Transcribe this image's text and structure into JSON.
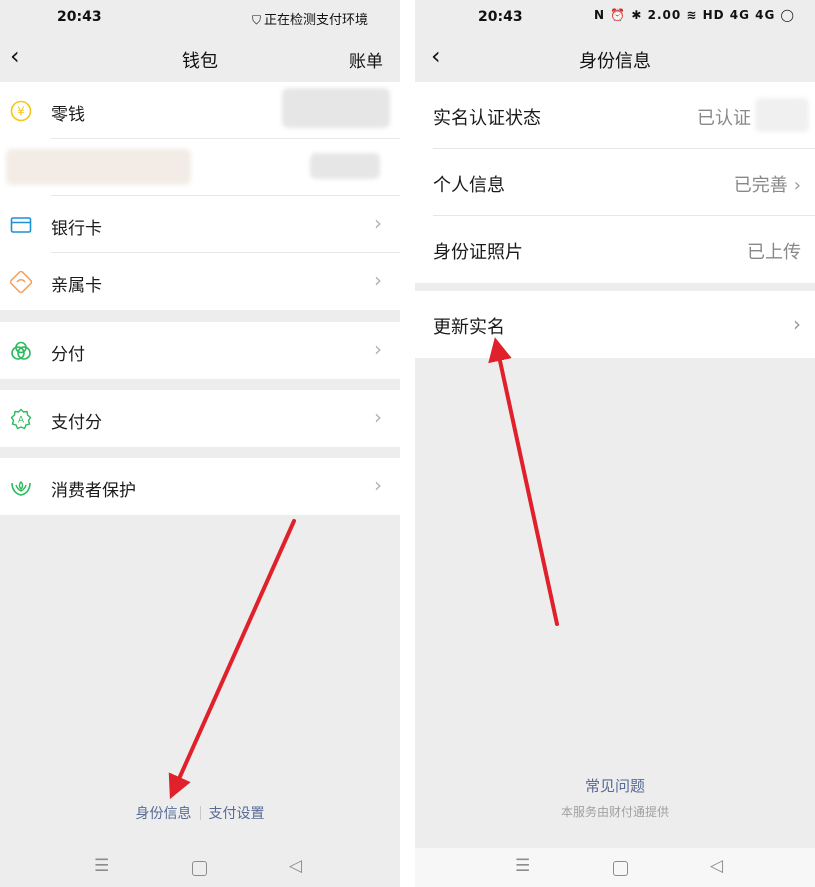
{
  "left": {
    "status": {
      "time": "20:43",
      "right_text": "正在检测支付环境"
    },
    "nav": {
      "title": "钱包",
      "action": "账单"
    },
    "groups": [
      [
        {
          "label": "零钱",
          "icon": "coin-icon",
          "chevron": false
        },
        {
          "label": "",
          "icon": "",
          "chevron": false
        },
        {
          "label": "银行卡",
          "icon": "bank-card-icon",
          "chevron": true
        },
        {
          "label": "亲属卡",
          "icon": "family-card-icon",
          "chevron": true
        }
      ],
      [
        {
          "label": "分付",
          "icon": "fenfu-icon",
          "chevron": true
        }
      ],
      [
        {
          "label": "支付分",
          "icon": "pay-score-icon",
          "chevron": true
        }
      ],
      [
        {
          "label": "消费者保护",
          "icon": "consumer-protection-icon",
          "chevron": true
        }
      ]
    ],
    "footer_links": [
      "身份信息",
      "支付设置"
    ]
  },
  "right": {
    "status": {
      "time": "20:43",
      "icons": "N ⏰ ✱ 2.00 ≋ HD 4G 4G ◯"
    },
    "nav": {
      "title": "身份信息"
    },
    "rows": [
      {
        "label": "实名认证状态",
        "value": "已认证",
        "chevron": false
      },
      {
        "label": "个人信息",
        "value": "已完善",
        "chevron": true
      },
      {
        "label": "身份证照片",
        "value": "已上传",
        "chevron": false
      }
    ],
    "update_row": {
      "label": "更新实名"
    },
    "faq": "常见问题",
    "provider": "本服务由财付通提供"
  },
  "nav_buttons": {
    "menu": "☰",
    "home": "",
    "back": "◁"
  },
  "glyphs": {
    "back": "‹",
    "chevron": "›",
    "shield": "⛉"
  },
  "colors": {
    "link": "#576b95",
    "coin": "#f5c518",
    "bank_card": "#1e90d6",
    "family_card": "#f5a25d",
    "green": "#2dba5f",
    "annotation_arrow": "#e0202a"
  }
}
